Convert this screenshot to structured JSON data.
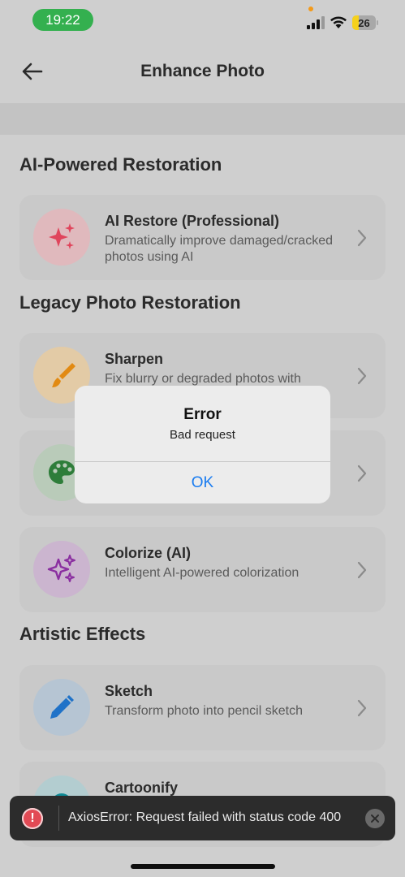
{
  "status_bar": {
    "time": "19:22",
    "battery_level": "26",
    "battery_fraction": 0.26
  },
  "header": {
    "title": "Enhance Photo",
    "back_icon": "arrow-left-icon"
  },
  "sections": {
    "ai": {
      "title": "AI-Powered Restoration"
    },
    "legacy": {
      "title": "Legacy Photo Restoration"
    },
    "artistic": {
      "title": "Artistic Effects"
    }
  },
  "cards": {
    "ai_restore": {
      "title": "AI Restore (Professional)",
      "desc": "Dramatically improve damaged/cracked photos using AI",
      "icon": "sparkles-icon",
      "icon_color": "#e0455c",
      "icon_bg": "#e0b9bd"
    },
    "sharpen": {
      "title": "Sharpen",
      "desc": "Fix blurry or degraded photos with",
      "icon": "paintbrush-icon",
      "icon_color": "#e28a12",
      "icon_bg": "#e3cba6"
    },
    "palette": {
      "title": "",
      "desc": "",
      "icon": "palette-icon",
      "icon_color": "#2e7d3a",
      "icon_bg": "#b9cbb9"
    },
    "colorize": {
      "title": "Colorize (AI)",
      "desc": "Intelligent AI-powered colorization",
      "icon": "sparkles-icon",
      "icon_color": "#8a2ea0",
      "icon_bg": "#cbb5cf"
    },
    "sketch": {
      "title": "Sketch",
      "desc": "Transform photo into pencil sketch",
      "icon": "pencil-icon",
      "icon_color": "#1f72c8",
      "icon_bg": "#b6c5d3"
    },
    "cartoonify": {
      "title": "Cartoonify",
      "desc": "",
      "icon": "cartoon-icon",
      "icon_color": "#0e8a95",
      "icon_bg": "#b3cdd0"
    }
  },
  "dialog": {
    "title": "Error",
    "message": "Bad request",
    "ok_label": "OK"
  },
  "toast": {
    "message": "AxiosError: Request failed with status code 400",
    "error_icon": "error-circle-icon",
    "close_icon": "close-icon"
  },
  "colors": {
    "accent": "#1a7cf0",
    "status_pill": "#34b04f",
    "toast_bg": "#2c2c2c",
    "error": "#e24a55"
  }
}
